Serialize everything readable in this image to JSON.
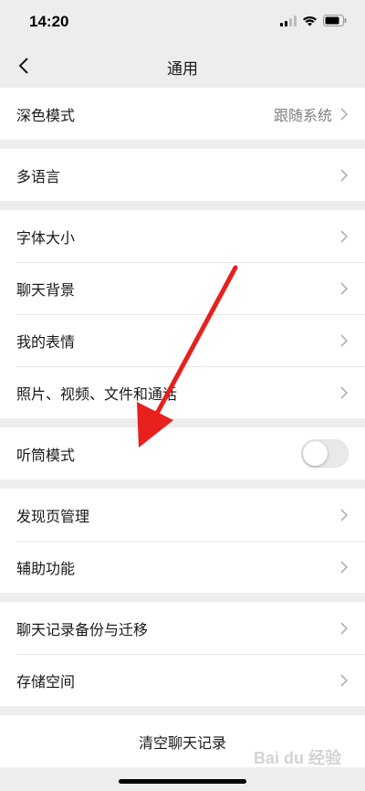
{
  "status": {
    "time": "14:20"
  },
  "nav": {
    "title": "通用"
  },
  "groups": {
    "dark_mode": {
      "label": "深色模式",
      "value": "跟随系统"
    },
    "language": {
      "label": "多语言"
    },
    "font_size": {
      "label": "字体大小"
    },
    "chat_bg": {
      "label": "聊天背景"
    },
    "stickers": {
      "label": "我的表情"
    },
    "media": {
      "label": "照片、视频、文件和通话"
    },
    "earpiece": {
      "label": "听筒模式",
      "enabled": false
    },
    "discover": {
      "label": "发现页管理"
    },
    "accessibility": {
      "label": "辅助功能"
    },
    "backup": {
      "label": "聊天记录备份与迁移"
    },
    "storage": {
      "label": "存储空间"
    },
    "clear": {
      "label": "清空聊天记录"
    }
  },
  "watermark": {
    "text": "Bai du 经验"
  },
  "colors": {
    "annotation_arrow": "#e8201e",
    "background": "#ededed"
  },
  "icons": [
    "back-icon",
    "chevron-right-icon",
    "signal-icon",
    "wifi-icon",
    "battery-icon"
  ]
}
